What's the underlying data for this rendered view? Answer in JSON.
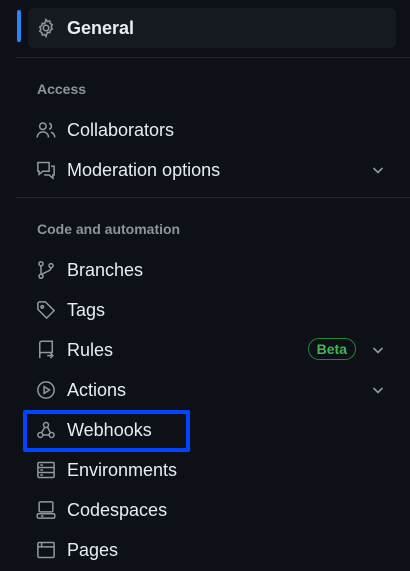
{
  "nav": {
    "general": {
      "label": "General",
      "icon": "gear-icon"
    },
    "access": {
      "heading": "Access",
      "items": [
        {
          "label": "Collaborators",
          "icon": "people-icon"
        },
        {
          "label": "Moderation options",
          "icon": "report-icon"
        }
      ]
    },
    "code_automation": {
      "heading": "Code and automation",
      "items": [
        {
          "label": "Branches",
          "icon": "git-branch-icon"
        },
        {
          "label": "Tags",
          "icon": "tag-icon"
        },
        {
          "label": "Rules",
          "icon": "repo-push-icon",
          "badge": "Beta"
        },
        {
          "label": "Actions",
          "icon": "play-icon"
        },
        {
          "label": "Webhooks",
          "icon": "webhook-icon"
        },
        {
          "label": "Environments",
          "icon": "server-icon"
        },
        {
          "label": "Codespaces",
          "icon": "codespaces-icon"
        },
        {
          "label": "Pages",
          "icon": "browser-icon"
        }
      ]
    }
  },
  "colors": {
    "background": "#0d1117",
    "active_bar": "#2f81f7",
    "badge": "#3fb950",
    "highlight": "#0044ff"
  }
}
